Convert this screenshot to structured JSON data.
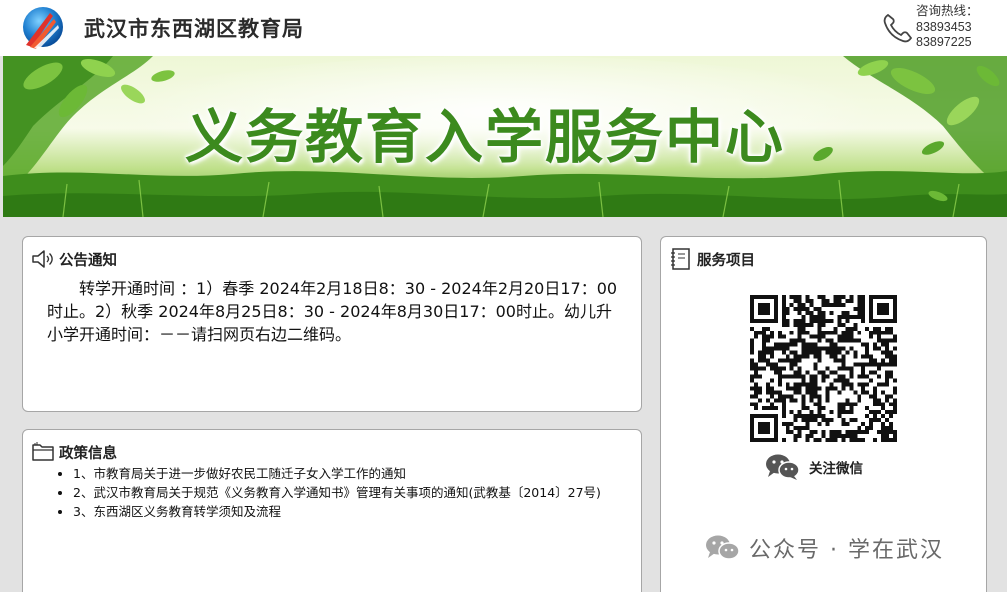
{
  "header": {
    "site_name": "武汉市东西湖区教育局",
    "hotline_label": "咨询热线：",
    "hotline_numbers": [
      "83893453",
      "83897225"
    ],
    "logo_icon": "emblem-logo-icon",
    "phone_icon": "phone-icon"
  },
  "banner": {
    "title": "义务教育入学服务中心"
  },
  "notice": {
    "title": "公告通知",
    "icon": "speaker-icon",
    "body": "转学开通时间 ：1）春季 2024年2月18日8：30 - 2024年2月20日17：00时止。2）秋季 2024年8月25日8：30 - 2024年8月30日17：00时止。幼儿升小学开通时间：－－请扫网页右边二维码。"
  },
  "policy": {
    "title": "政策信息",
    "icon": "folder-icon",
    "items": [
      "1、市教育局关于进一步做好农民工随迁子女入学工作的通知",
      "2、武汉市教育局关于规范《义务教育入学通知书》管理有关事项的通知(武教基〔2014〕27号)",
      "3、东西湖区义务教育转学须知及流程"
    ]
  },
  "service": {
    "title": "服务项目",
    "icon": "notebook-icon",
    "qr_icon": "qr-code-icon",
    "wechat_icon": "wechat-icon",
    "wechat_label": "关注微信"
  },
  "watermark": {
    "text": "公众号 · 学在武汉",
    "icon": "wechat-icon"
  },
  "colors": {
    "page_bg": "#e2e2e2",
    "banner_title": "#3c8a1e",
    "panel_border": "#a6a6a6"
  }
}
